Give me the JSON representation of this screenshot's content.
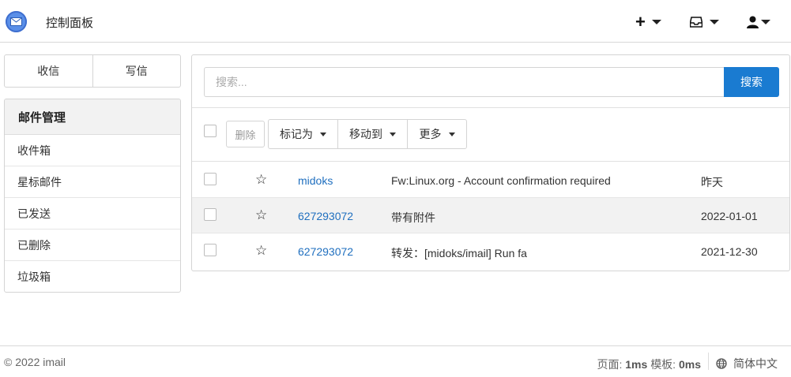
{
  "navbar": {
    "title": "控制面板",
    "logo_icon": "mail-icon",
    "plus_symbol": "+",
    "accent": "#1a7bd1"
  },
  "sidebar": {
    "compose_tabs": [
      {
        "label": "收信"
      },
      {
        "label": "写信"
      }
    ],
    "panel_title": "邮件管理",
    "items": [
      {
        "label": "收件箱"
      },
      {
        "label": "星标邮件"
      },
      {
        "label": "已发送"
      },
      {
        "label": "已删除"
      },
      {
        "label": "垃圾箱"
      }
    ]
  },
  "search": {
    "placeholder": "搜索...",
    "value": "",
    "button_label": "搜索"
  },
  "toolbar": {
    "delete_label": "删除",
    "mark_as_label": "标记为",
    "move_to_label": "移动到",
    "more_label": "更多"
  },
  "mail_rows": [
    {
      "from": "midoks",
      "subject": "Fw:Linux.org - Account confirmation required",
      "date": "昨天",
      "starred": false
    },
    {
      "from": "627293072",
      "subject": "带有附件",
      "date": "2022-01-01",
      "starred": false
    },
    {
      "from": "627293072",
      "subject": "转发：[midoks/imail] Run fa",
      "date": "2021-12-30",
      "starred": false
    }
  ],
  "footer": {
    "copyright": "© 2022 imail",
    "page_label": "页面:",
    "page_time": "1ms",
    "template_label": "模板:",
    "template_time": "0ms",
    "language": "简体中文"
  }
}
